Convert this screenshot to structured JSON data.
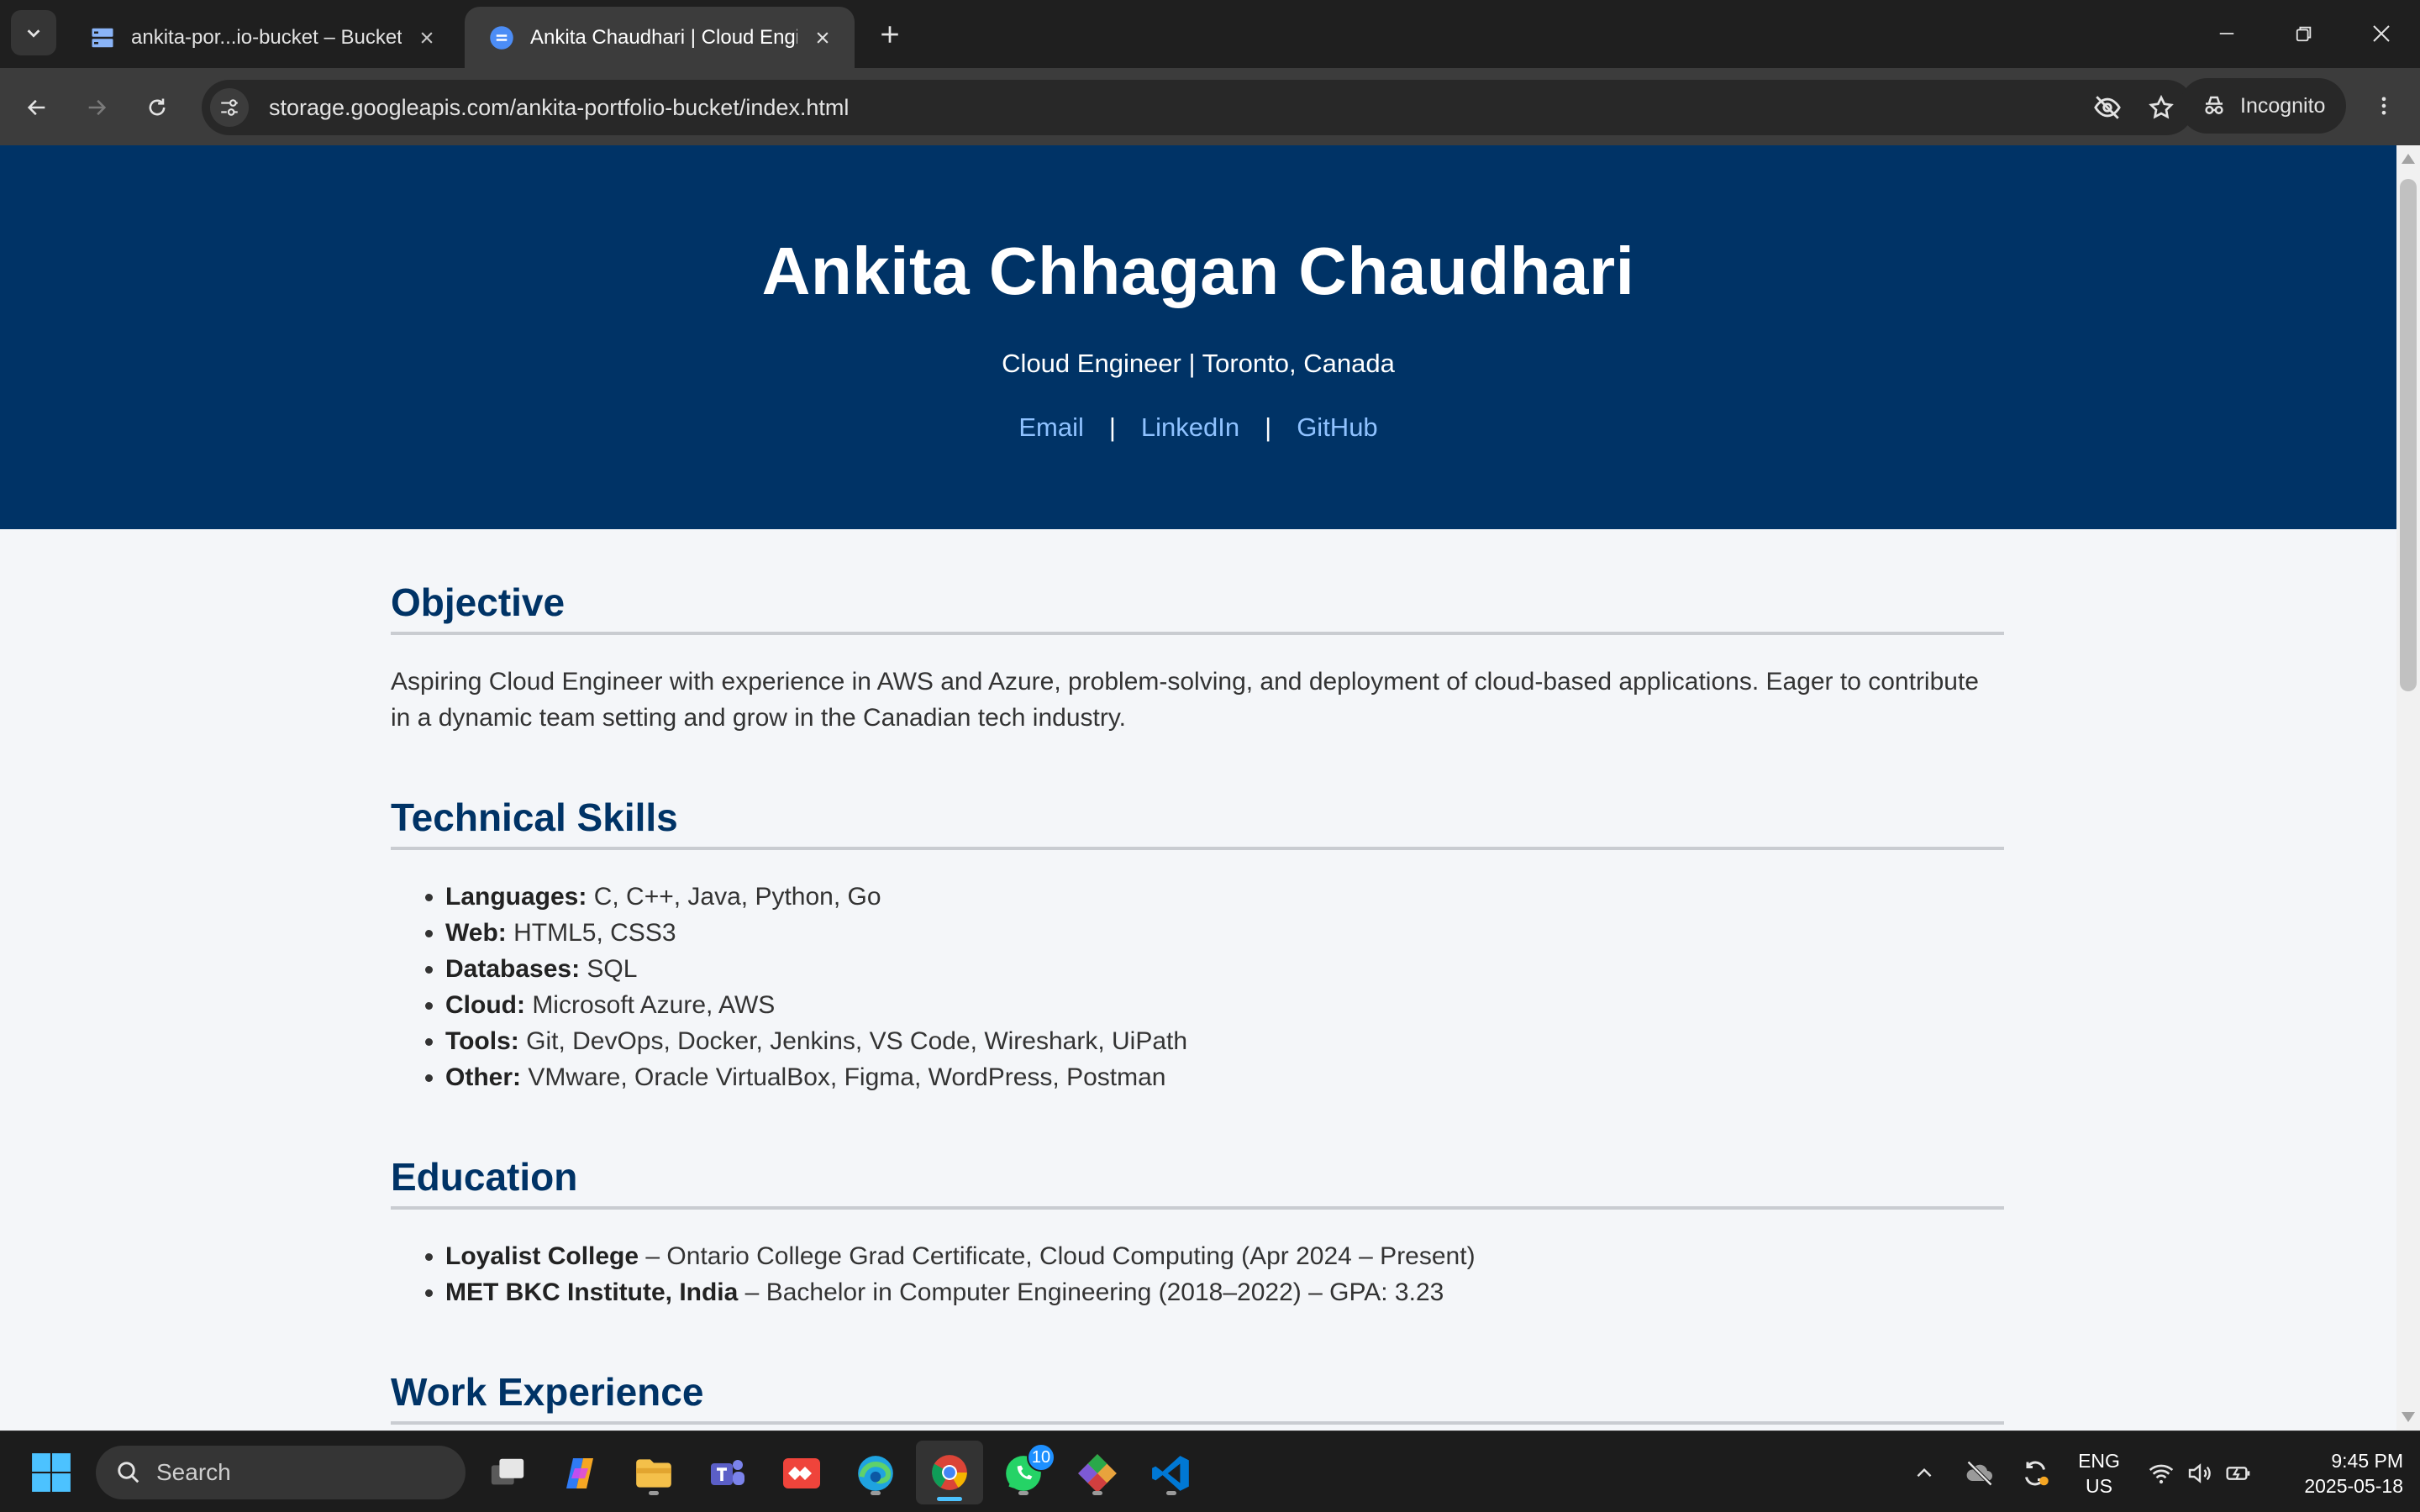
{
  "browser": {
    "tabs": [
      {
        "title": "ankita-por...io-bucket – Bucket",
        "active": false
      },
      {
        "title": "Ankita Chaudhari | Cloud Engine",
        "active": true
      }
    ],
    "url": "storage.googleapis.com/ankita-portfolio-bucket/index.html",
    "profile_label": "Incognito"
  },
  "page": {
    "name": "Ankita Chhagan Chaudhari",
    "subtitle": "Cloud Engineer | Toronto, Canada",
    "links": [
      {
        "label": "Email"
      },
      {
        "label": "LinkedIn"
      },
      {
        "label": "GitHub"
      }
    ],
    "link_separator": "|",
    "objective": {
      "title": "Objective",
      "text": "Aspiring Cloud Engineer with experience in AWS and Azure, problem-solving, and deployment of cloud-based applications. Eager to contribute in a dynamic team setting and grow in the Canadian tech industry."
    },
    "skills": {
      "title": "Technical Skills",
      "items": [
        {
          "label": "Languages:",
          "value": "C, C++, Java, Python, Go"
        },
        {
          "label": "Web:",
          "value": "HTML5, CSS3"
        },
        {
          "label": "Databases:",
          "value": "SQL"
        },
        {
          "label": "Cloud:",
          "value": "Microsoft Azure, AWS"
        },
        {
          "label": "Tools:",
          "value": "Git, DevOps, Docker, Jenkins, VS Code, Wireshark, UiPath"
        },
        {
          "label": "Other:",
          "value": "VMware, Oracle VirtualBox, Figma, WordPress, Postman"
        }
      ]
    },
    "education": {
      "title": "Education",
      "items": [
        {
          "school": "Loyalist College",
          "detail": "– Ontario College Grad Certificate, Cloud Computing (Apr 2024 – Present)"
        },
        {
          "school": "MET BKC Institute, India",
          "detail": "– Bachelor in Computer Engineering (2018–2022) – GPA: 3.23"
        }
      ]
    },
    "work": {
      "title": "Work Experience"
    }
  },
  "taskbar": {
    "search_label": "Search",
    "apps": [
      "task-view",
      "copilot",
      "file-explorer",
      "teams",
      "anydesk",
      "edge",
      "chrome",
      "whatsapp",
      "git",
      "vscode"
    ],
    "whatsapp_badge": "10",
    "lang_line1": "ENG",
    "lang_line2": "US",
    "time": "9:45 PM",
    "date": "2025-05-18"
  },
  "colors": {
    "hero_bg": "#003366",
    "accent_link": "#8fc2ff",
    "section_title": "#003366",
    "page_bg": "#f4f6f9"
  }
}
